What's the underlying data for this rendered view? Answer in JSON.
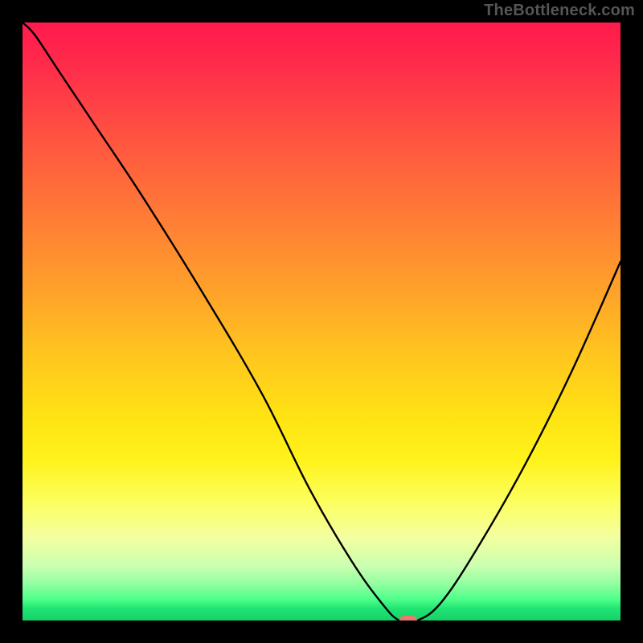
{
  "watermark": "TheBottleneck.com",
  "colors": {
    "curve_stroke": "#000000",
    "marker_fill": "#e77a6a",
    "frame_bg": "#000000"
  },
  "chart_data": {
    "type": "line",
    "title": "",
    "xlabel": "",
    "ylabel": "",
    "xlim": [
      0,
      100
    ],
    "ylim": [
      0,
      100
    ],
    "series": [
      {
        "name": "bottleneck-curve",
        "x": [
          0,
          2,
          6,
          12,
          20,
          30,
          40,
          48,
          55,
          60,
          63,
          66,
          70,
          76,
          84,
          92,
          100
        ],
        "y": [
          100,
          98,
          92,
          83,
          71,
          55,
          38,
          22,
          10,
          3,
          0,
          0,
          3,
          12,
          26,
          42,
          60
        ]
      }
    ],
    "annotations": [
      {
        "name": "optimal-marker",
        "x": 64.5,
        "y": 0
      }
    ],
    "gradient_stops_percent": [
      {
        "pct": 0,
        "color": "#ff1a4d"
      },
      {
        "pct": 45,
        "color": "#ffa22a"
      },
      {
        "pct": 73,
        "color": "#fff21a"
      },
      {
        "pct": 96,
        "color": "#4dff8a"
      },
      {
        "pct": 100,
        "color": "#16d168"
      }
    ]
  }
}
